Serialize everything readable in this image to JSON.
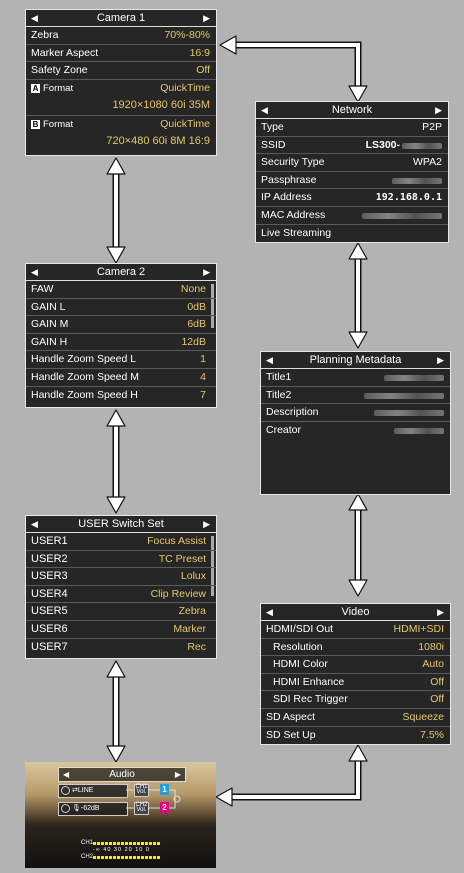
{
  "camera1": {
    "title": "Camera 1",
    "rows": [
      {
        "label": "Zebra",
        "value": "70%-80%"
      },
      {
        "label": "Marker Aspect",
        "value": "16:9"
      },
      {
        "label": "Safety Zone",
        "value": "Off"
      }
    ],
    "format_a": {
      "badge": "A",
      "label": "Format",
      "value": "QuickTime",
      "detail": "1920×1080  60i  35M"
    },
    "format_b": {
      "badge": "B",
      "label": "Format",
      "value": "QuickTime",
      "detail": "720×480  60i  8M  16:9"
    }
  },
  "network": {
    "title": "Network",
    "rows": [
      {
        "label": "Type",
        "value": "P2P"
      },
      {
        "label": "SSID",
        "value": "LS300-"
      },
      {
        "label": "Security Type",
        "value": "WPA2"
      },
      {
        "label": "Passphrase",
        "value": ""
      },
      {
        "label": "IP Address",
        "value": "192.168.0.1"
      },
      {
        "label": "MAC Address",
        "value": ""
      },
      {
        "label": "Live Streaming",
        "value": ""
      }
    ]
  },
  "camera2": {
    "title": "Camera 2",
    "rows": [
      {
        "label": "FAW",
        "value": "None"
      },
      {
        "label": "GAIN L",
        "value": "0dB"
      },
      {
        "label": "GAIN M",
        "value": "6dB"
      },
      {
        "label": "GAIN H",
        "value": "12dB"
      },
      {
        "label": "Handle Zoom Speed L",
        "value": "1"
      },
      {
        "label": "Handle Zoom Speed M",
        "value": "4"
      },
      {
        "label": "Handle Zoom Speed H",
        "value": "7"
      }
    ]
  },
  "planning": {
    "title": "Planning Metadata",
    "rows": [
      {
        "label": "Title1"
      },
      {
        "label": "Title2"
      },
      {
        "label": "Description"
      },
      {
        "label": "Creator"
      }
    ]
  },
  "user_switch": {
    "title": "USER Switch Set",
    "rows": [
      {
        "label": "USER1",
        "value": "Focus Assist"
      },
      {
        "label": "USER2",
        "value": "TC Preset"
      },
      {
        "label": "USER3",
        "value": "Lolux"
      },
      {
        "label": "USER4",
        "value": "Clip Review"
      },
      {
        "label": "USER5",
        "value": "Zebra"
      },
      {
        "label": "USER6",
        "value": "Marker"
      },
      {
        "label": "USER7",
        "value": "Rec"
      }
    ]
  },
  "video": {
    "title": "Video",
    "rows": [
      {
        "label": "HDMI/SDI Out",
        "value": "HDMI+SDI"
      },
      {
        "label": "Resolution",
        "value": "1080i"
      },
      {
        "label": "HDMI Color",
        "value": "Auto"
      },
      {
        "label": "HDMI Enhance",
        "value": "Off"
      },
      {
        "label": "SDI Rec Trigger",
        "value": "Off"
      },
      {
        "label": "SD Aspect",
        "value": "Squeeze"
      },
      {
        "label": "SD Set Up",
        "value": "7.5%"
      }
    ]
  },
  "audio": {
    "title": "Audio",
    "ch1_input": "LINE",
    "ch2_input": "-62dB",
    "ch1_vol": "CH1 Vol.",
    "ch2_vol": "CH2 Vol.",
    "ch1_num": "1",
    "ch2_num": "2",
    "meter_ch1": "CH1",
    "meter_ch2": "CH2",
    "meter_scale": "-∞ 40 30 20 10 0"
  },
  "nav": {
    "left": "◀",
    "right": "▶"
  },
  "colors": {
    "value_text": "#e6c76a",
    "ch1_accent": "#1ea0dc",
    "ch2_accent": "#e4007f"
  }
}
